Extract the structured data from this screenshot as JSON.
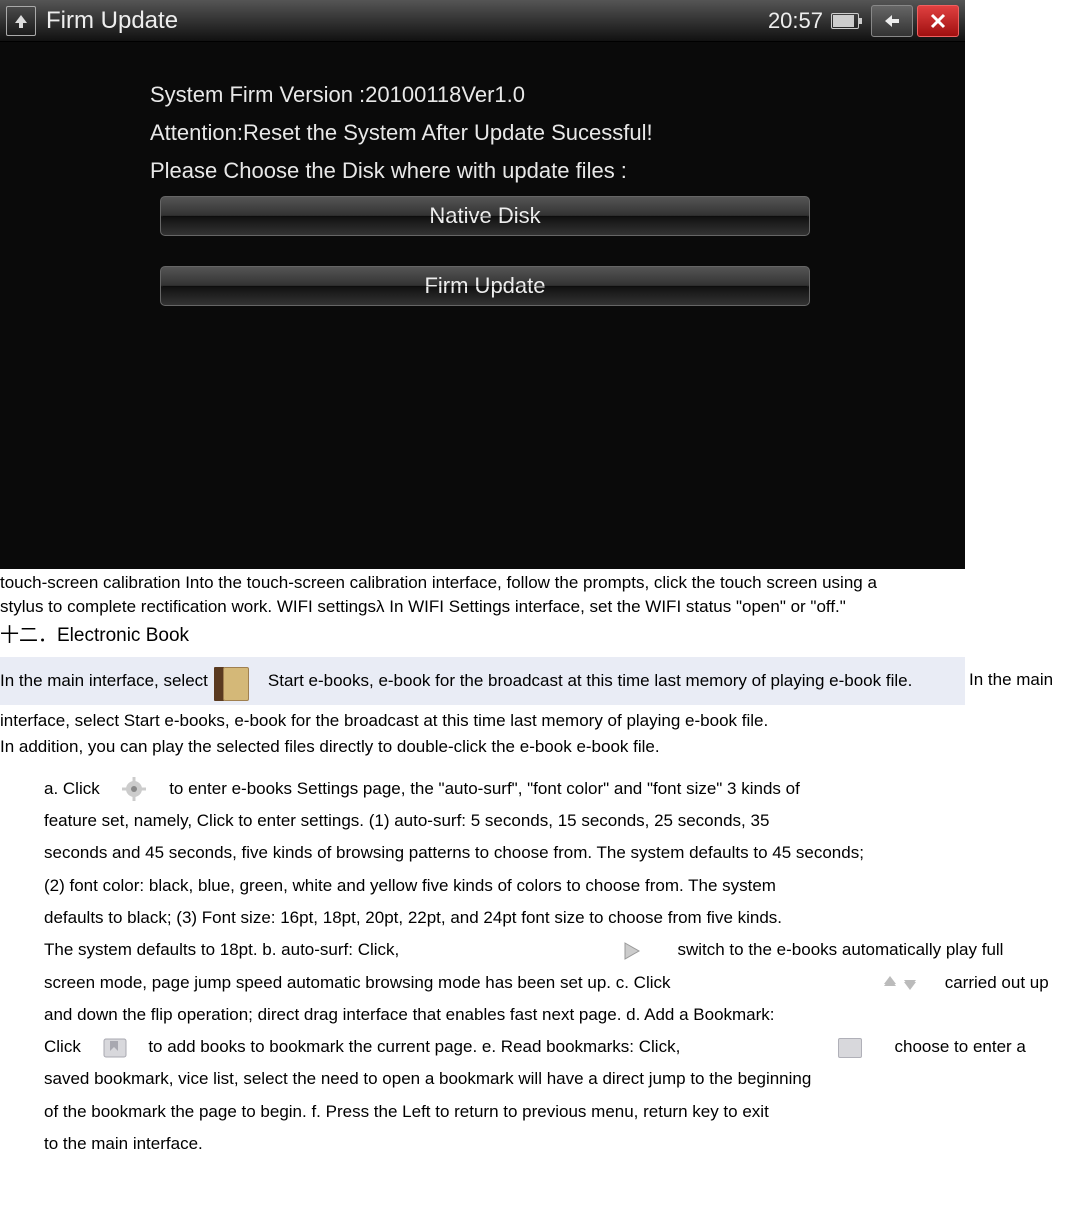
{
  "device": {
    "title": "Firm Update",
    "clock": "20:57",
    "body": {
      "line1": "System Firm Version :20100118Ver1.0",
      "line2": "Attention:Reset the System After Update Sucessful!",
      "line3": "Please Choose the Disk where with update files :",
      "button1": "Native Disk",
      "button2": "Firm Update"
    }
  },
  "doc": {
    "para1": "touch-screen calibration Into the touch-screen calibration interface, follow the prompts, click the touch screen using a stylus to complete rectification work. WIFI settingsλ In WIFI Settings interface, set the WIFI status \"open\" or \"off.\"",
    "heading": "十二．Electronic Book",
    "highlight_pre": "In the main interface, select",
    "highlight_post": "Start e-books, e-book for the broadcast at this time last memory of playing e-book file.",
    "trail": "In the main",
    "para2": "interface, select Start e-books, e-book for the broadcast at this time last memory of playing e-book file.",
    "para3": "In addition, you can play the selected files directly to double-click the e-book e-book file.",
    "sub": {
      "a1": "a. Click",
      "a2": "to enter e-books Settings page, the \"auto-surf\", \"font color\" and \"font size\" 3 kinds of",
      "a3": "feature set, namely, Click to enter settings.         (1) auto-surf: 5 seconds, 15 seconds, 25 seconds, 35",
      "a4": "seconds and 45 seconds, five kinds of browsing patterns to choose from. The system defaults to 45 seconds;",
      "a5": "(2) font color: black, blue, green, white and yellow five kinds of colors to choose from. The system",
      "a6": "defaults to black;               (3) Font size: 16pt, 18pt, 20pt, 22pt, and 24pt font size to choose from five kinds.",
      "a7a": "The system defaults to 18pt.          b. auto-surf: Click,",
      "a7b": "switch to the e-books automatically play full",
      "a8a": "screen mode, page jump speed automatic browsing mode has been set up.          c. Click",
      "a8b": "carried out up",
      "a9": "and down the flip operation; direct drag interface that enables fast next page.      d. Add a Bookmark:",
      "a10a": "Click",
      "a10b": "to add books to bookmark the current page.           e. Read bookmarks: Click,",
      "a10c": "choose to enter a",
      "a11": "saved bookmark, vice list, select the need to open a bookmark will have a direct jump to the beginning",
      "a12": "of the bookmark the page to begin.         f. Press the Left to return to previous menu, return key to exit",
      "a13": "to the main interface."
    }
  }
}
